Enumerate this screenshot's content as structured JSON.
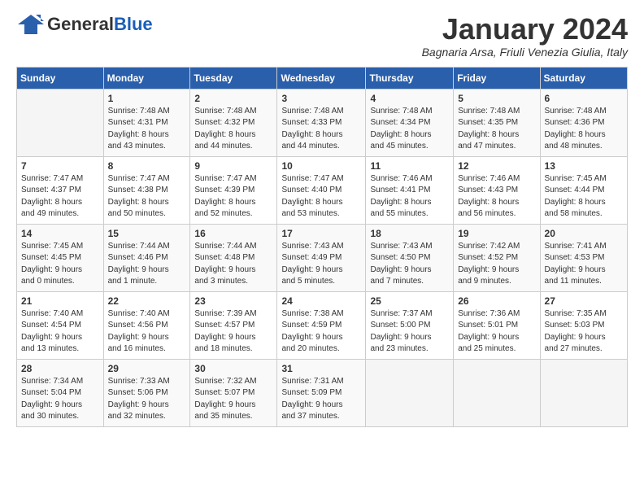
{
  "logo": {
    "general": "General",
    "blue": "Blue"
  },
  "title": "January 2024",
  "subtitle": "Bagnaria Arsa, Friuli Venezia Giulia, Italy",
  "days_of_week": [
    "Sunday",
    "Monday",
    "Tuesday",
    "Wednesday",
    "Thursday",
    "Friday",
    "Saturday"
  ],
  "weeks": [
    [
      {
        "day": "",
        "info": ""
      },
      {
        "day": "1",
        "info": "Sunrise: 7:48 AM\nSunset: 4:31 PM\nDaylight: 8 hours\nand 43 minutes."
      },
      {
        "day": "2",
        "info": "Sunrise: 7:48 AM\nSunset: 4:32 PM\nDaylight: 8 hours\nand 44 minutes."
      },
      {
        "day": "3",
        "info": "Sunrise: 7:48 AM\nSunset: 4:33 PM\nDaylight: 8 hours\nand 44 minutes."
      },
      {
        "day": "4",
        "info": "Sunrise: 7:48 AM\nSunset: 4:34 PM\nDaylight: 8 hours\nand 45 minutes."
      },
      {
        "day": "5",
        "info": "Sunrise: 7:48 AM\nSunset: 4:35 PM\nDaylight: 8 hours\nand 47 minutes."
      },
      {
        "day": "6",
        "info": "Sunrise: 7:48 AM\nSunset: 4:36 PM\nDaylight: 8 hours\nand 48 minutes."
      }
    ],
    [
      {
        "day": "7",
        "info": "Sunrise: 7:47 AM\nSunset: 4:37 PM\nDaylight: 8 hours\nand 49 minutes."
      },
      {
        "day": "8",
        "info": "Sunrise: 7:47 AM\nSunset: 4:38 PM\nDaylight: 8 hours\nand 50 minutes."
      },
      {
        "day": "9",
        "info": "Sunrise: 7:47 AM\nSunset: 4:39 PM\nDaylight: 8 hours\nand 52 minutes."
      },
      {
        "day": "10",
        "info": "Sunrise: 7:47 AM\nSunset: 4:40 PM\nDaylight: 8 hours\nand 53 minutes."
      },
      {
        "day": "11",
        "info": "Sunrise: 7:46 AM\nSunset: 4:41 PM\nDaylight: 8 hours\nand 55 minutes."
      },
      {
        "day": "12",
        "info": "Sunrise: 7:46 AM\nSunset: 4:43 PM\nDaylight: 8 hours\nand 56 minutes."
      },
      {
        "day": "13",
        "info": "Sunrise: 7:45 AM\nSunset: 4:44 PM\nDaylight: 8 hours\nand 58 minutes."
      }
    ],
    [
      {
        "day": "14",
        "info": "Sunrise: 7:45 AM\nSunset: 4:45 PM\nDaylight: 9 hours\nand 0 minutes."
      },
      {
        "day": "15",
        "info": "Sunrise: 7:44 AM\nSunset: 4:46 PM\nDaylight: 9 hours\nand 1 minute."
      },
      {
        "day": "16",
        "info": "Sunrise: 7:44 AM\nSunset: 4:48 PM\nDaylight: 9 hours\nand 3 minutes."
      },
      {
        "day": "17",
        "info": "Sunrise: 7:43 AM\nSunset: 4:49 PM\nDaylight: 9 hours\nand 5 minutes."
      },
      {
        "day": "18",
        "info": "Sunrise: 7:43 AM\nSunset: 4:50 PM\nDaylight: 9 hours\nand 7 minutes."
      },
      {
        "day": "19",
        "info": "Sunrise: 7:42 AM\nSunset: 4:52 PM\nDaylight: 9 hours\nand 9 minutes."
      },
      {
        "day": "20",
        "info": "Sunrise: 7:41 AM\nSunset: 4:53 PM\nDaylight: 9 hours\nand 11 minutes."
      }
    ],
    [
      {
        "day": "21",
        "info": "Sunrise: 7:40 AM\nSunset: 4:54 PM\nDaylight: 9 hours\nand 13 minutes."
      },
      {
        "day": "22",
        "info": "Sunrise: 7:40 AM\nSunset: 4:56 PM\nDaylight: 9 hours\nand 16 minutes."
      },
      {
        "day": "23",
        "info": "Sunrise: 7:39 AM\nSunset: 4:57 PM\nDaylight: 9 hours\nand 18 minutes."
      },
      {
        "day": "24",
        "info": "Sunrise: 7:38 AM\nSunset: 4:59 PM\nDaylight: 9 hours\nand 20 minutes."
      },
      {
        "day": "25",
        "info": "Sunrise: 7:37 AM\nSunset: 5:00 PM\nDaylight: 9 hours\nand 23 minutes."
      },
      {
        "day": "26",
        "info": "Sunrise: 7:36 AM\nSunset: 5:01 PM\nDaylight: 9 hours\nand 25 minutes."
      },
      {
        "day": "27",
        "info": "Sunrise: 7:35 AM\nSunset: 5:03 PM\nDaylight: 9 hours\nand 27 minutes."
      }
    ],
    [
      {
        "day": "28",
        "info": "Sunrise: 7:34 AM\nSunset: 5:04 PM\nDaylight: 9 hours\nand 30 minutes."
      },
      {
        "day": "29",
        "info": "Sunrise: 7:33 AM\nSunset: 5:06 PM\nDaylight: 9 hours\nand 32 minutes."
      },
      {
        "day": "30",
        "info": "Sunrise: 7:32 AM\nSunset: 5:07 PM\nDaylight: 9 hours\nand 35 minutes."
      },
      {
        "day": "31",
        "info": "Sunrise: 7:31 AM\nSunset: 5:09 PM\nDaylight: 9 hours\nand 37 minutes."
      },
      {
        "day": "",
        "info": ""
      },
      {
        "day": "",
        "info": ""
      },
      {
        "day": "",
        "info": ""
      }
    ]
  ]
}
